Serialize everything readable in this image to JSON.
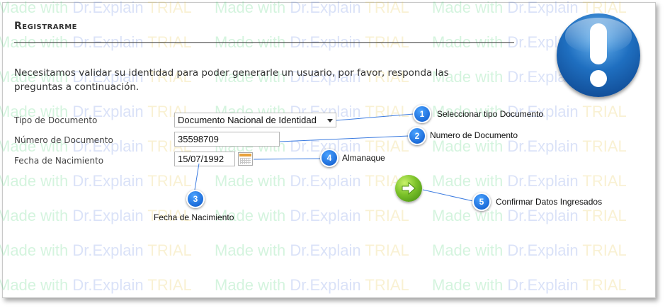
{
  "watermark": {
    "made": "Made with ",
    "dr": "Dr.Explain ",
    "trial": "TRIAL"
  },
  "form": {
    "title": "Registrarme",
    "intro": "Necesitamos validar su identidad para poder generarle un usuario, por favor, responda las preguntas a continuación.",
    "fields": {
      "doc_type_label": "Tipo de Documento",
      "doc_type_value": "Documento Nacional de Identidad",
      "doc_number_label": "Número de Documento",
      "doc_number_value": "35598709",
      "birth_label": "Fecha de Nacimiento",
      "birth_value": "15/07/1992"
    }
  },
  "callouts": [
    {
      "number": "1",
      "text": "Seleccionar tipo Documento"
    },
    {
      "number": "2",
      "text": "Numero de Documento"
    },
    {
      "number": "3",
      "text": "Fecha de Nacimiento"
    },
    {
      "number": "4",
      "text": "Almanaque"
    },
    {
      "number": "5",
      "text": "Confirmar Datos Ingresados"
    }
  ],
  "icons": {
    "info": "exclamation-icon",
    "calendar": "calendar-icon",
    "confirm": "arrow-right-icon"
  },
  "colors": {
    "badge": "#0a55c9",
    "callout_line": "#3b7be0",
    "confirm_button": "#7cc22a",
    "info_icon": "#1f6fc0"
  }
}
